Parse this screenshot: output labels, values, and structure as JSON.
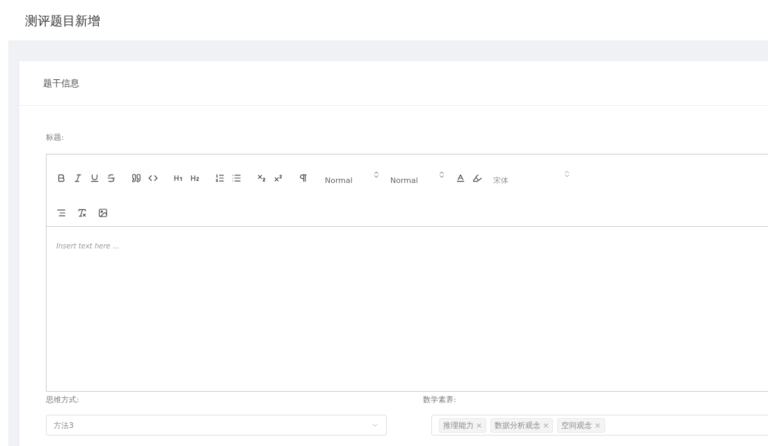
{
  "page_title": "测评题目新增",
  "card": {
    "title": "题干信息",
    "title_field": {
      "label": "标题:",
      "toolbar": {
        "header_select": "Normal",
        "size_select": "Normal",
        "font_select": "宋体"
      },
      "placeholder": "Insert text here ..."
    },
    "thinking_method": {
      "label": "思维方式:",
      "value": "方法3"
    },
    "math_literacy": {
      "label": "数学素养:",
      "tags": [
        {
          "label": "推理能力",
          "remove": "×"
        },
        {
          "label": "数据分析观念",
          "remove": "×"
        },
        {
          "label": "空间观念",
          "remove": "×"
        }
      ]
    }
  }
}
